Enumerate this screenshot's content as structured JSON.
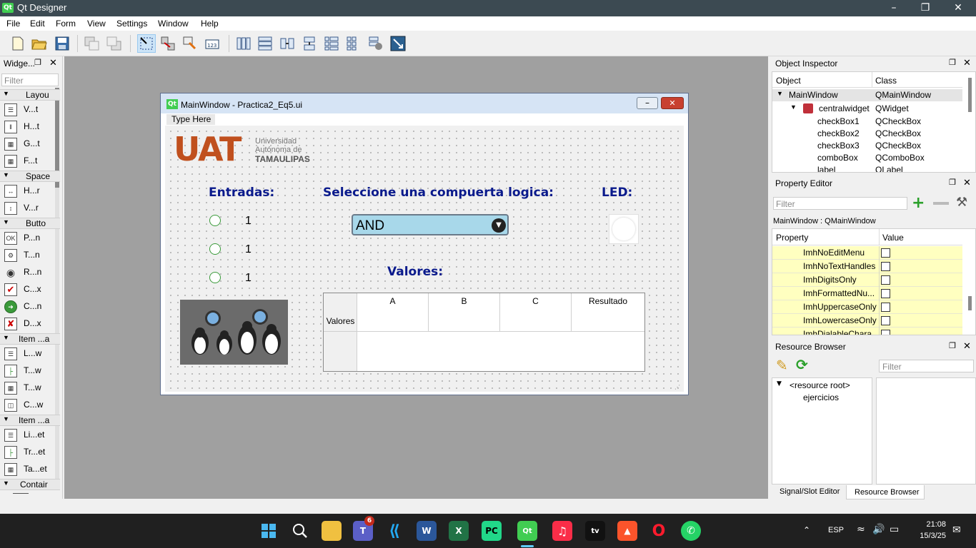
{
  "app": {
    "title": "Qt Designer",
    "logo": "Qt"
  },
  "menu": [
    "File",
    "Edit",
    "Form",
    "View",
    "Settings",
    "Window",
    "Help"
  ],
  "widget_box": {
    "title": "Widge...",
    "filter_placeholder": "Filter",
    "categories": {
      "layouts": "Layou",
      "spacers": "Space",
      "buttons": "Butto",
      "item_views_model": "Item ...a",
      "item_widgets": "Item ...a",
      "containers": "Contair"
    },
    "items": {
      "vertical_layout": "V...t",
      "horizontal_layout": "H...t",
      "grid_layout": "G...t",
      "form_layout": "F...t",
      "horizontal_spacer": "H...r",
      "vertical_spacer": "V...r",
      "push_button": "P...n",
      "tool_button": "T...n",
      "radio_button": "R...n",
      "check_box": "C...x",
      "command_link": "C...n",
      "dialog_button_box": "D...x",
      "list_view": "L...w",
      "tree_view": "T...w",
      "table_view": "T...w",
      "column_view": "C...w",
      "list_widget": "Li...et",
      "tree_widget": "Tr...et",
      "table_widget": "Ta...et"
    }
  },
  "form": {
    "window_title": "MainWindow - Practica2_Eq5.ui",
    "menu_placeholder": "Type Here",
    "logo": {
      "main": "UAT",
      "line1": "Universidad",
      "line2": "Autónoma de",
      "line3": "TAMAULIPAS"
    },
    "entradas_label": "Entradas:",
    "gate_label": "Seleccione una compuerta logica:",
    "led_label": "LED:",
    "inputs": [
      {
        "value": "1"
      },
      {
        "value": "1"
      },
      {
        "value": "1"
      }
    ],
    "combo_value": "AND",
    "valores_label": "Valores:",
    "table": {
      "row_header": "Valores",
      "columns": [
        "A",
        "B",
        "C",
        "Resultado"
      ]
    }
  },
  "object_inspector": {
    "title": "Object Inspector",
    "col_object": "Object",
    "col_class": "Class",
    "rows": [
      {
        "object": "MainWindow",
        "class": "QMainWindow"
      },
      {
        "object": "centralwidget",
        "class": "QWidget"
      },
      {
        "object": "checkBox1",
        "class": "QCheckBox"
      },
      {
        "object": "checkBox2",
        "class": "QCheckBox"
      },
      {
        "object": "checkBox3",
        "class": "QCheckBox"
      },
      {
        "object": "comboBox",
        "class": "QComboBox"
      },
      {
        "object": "label",
        "class": "QLabel"
      }
    ]
  },
  "property_editor": {
    "title": "Property Editor",
    "filter_placeholder": "Filter",
    "context": "MainWindow : QMainWindow",
    "col_property": "Property",
    "col_value": "Value",
    "rows": [
      {
        "name": "ImhNoEditMenu",
        "checked": false
      },
      {
        "name": "ImhNoTextHandles",
        "checked": false
      },
      {
        "name": "ImhDigitsOnly",
        "checked": false
      },
      {
        "name": "ImhFormattedNu...",
        "checked": false
      },
      {
        "name": "ImhUppercaseOnly",
        "checked": false
      },
      {
        "name": "ImhLowercaseOnly",
        "checked": false
      },
      {
        "name": "ImhDialableChara",
        "checked": false
      }
    ]
  },
  "resource_browser": {
    "title": "Resource Browser",
    "filter_placeholder": "Filter",
    "tree": [
      "<resource root>",
      "ejercicios"
    ],
    "tabs": [
      "Signal/Slot Editor",
      "Resource Browser"
    ]
  },
  "taskbar": {
    "teams_badge": "6",
    "language": "ESP",
    "time": "21:08",
    "date": "15/3/25"
  },
  "colors": {
    "label_blue": "#0a1a8c",
    "combo_bg": "#a8d8ea",
    "uat_orange": "#c0501e",
    "property_highlight": "#ffffc0"
  }
}
